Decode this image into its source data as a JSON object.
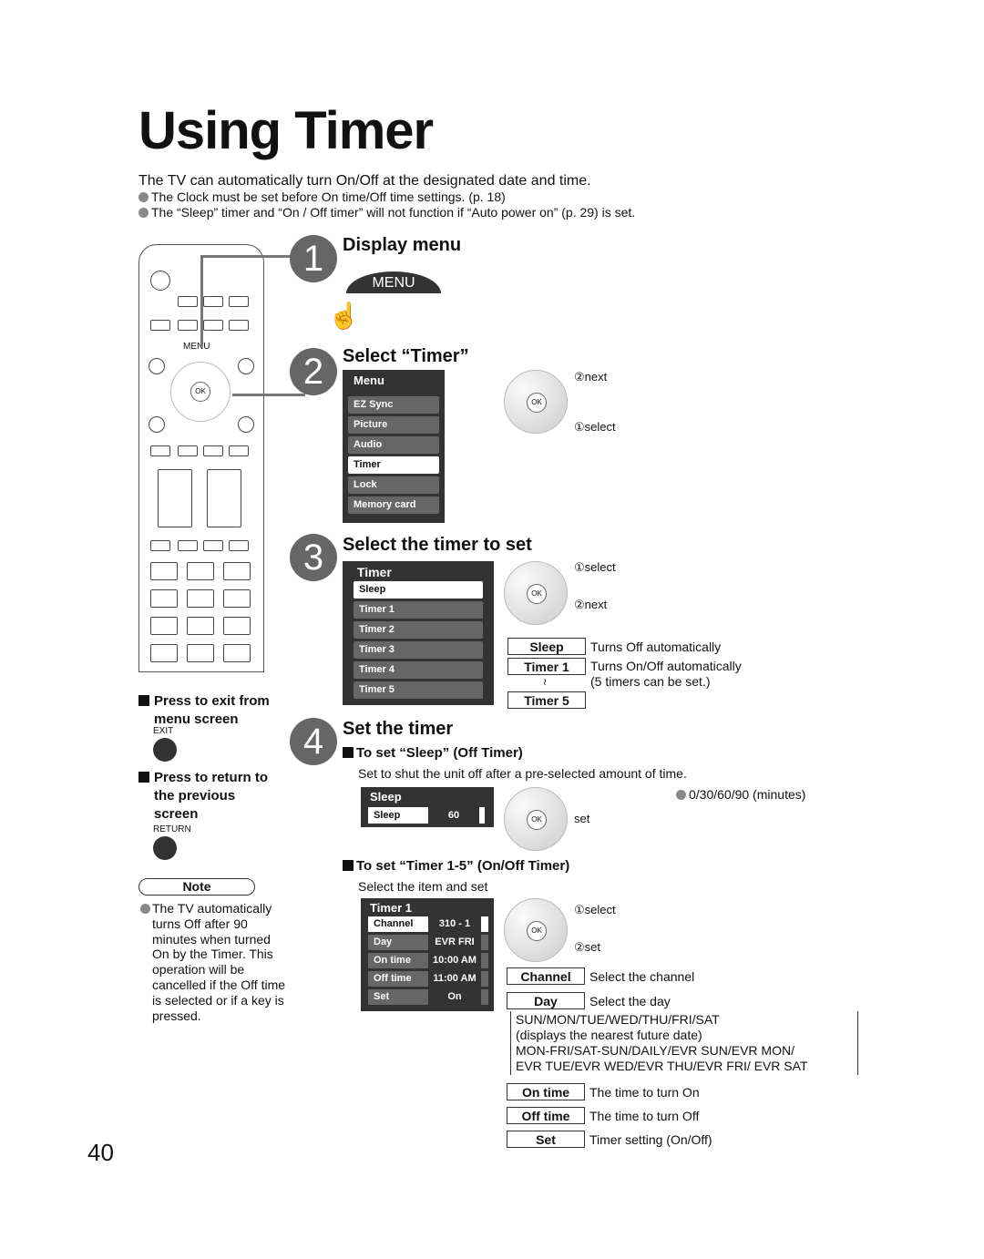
{
  "title": "Using Timer",
  "intro": "The TV can automatically turn On/Off at the designated date and time.",
  "bullets": [
    "The Clock must be set before On time/Off time settings. (p. 18)",
    "The “Sleep” timer and “On / Off timer” will not function if “Auto power on” (p. 29) is set."
  ],
  "remote": {
    "menu_label": "MENU",
    "ok_label": "OK"
  },
  "steps": [
    {
      "num": "1",
      "title": "Display menu",
      "button": "MENU"
    },
    {
      "num": "2",
      "title": "Select “Timer”",
      "menu": {
        "header": "Menu",
        "items": [
          "EZ Sync",
          "Picture",
          "Audio",
          "Timer",
          "Lock",
          "Memory card"
        ]
      },
      "next": "②next",
      "select": "①select"
    },
    {
      "num": "3",
      "title": "Select the timer to set",
      "menu": {
        "header": "Timer",
        "items": [
          "Sleep",
          "Timer 1",
          "Timer 2",
          "Timer 3",
          "Timer 4",
          "Timer 5"
        ]
      },
      "select": "①select",
      "next": "②next",
      "keys": [
        {
          "key": "Sleep",
          "desc": "Turns Off automatically"
        },
        {
          "key": "Timer 1",
          "desc": "Turns On/Off automatically"
        },
        {
          "key": "Timer 5",
          "desc": "(5 timers can be set.)"
        }
      ],
      "tilde": "≀"
    },
    {
      "num": "4",
      "title": "Set the timer"
    }
  ],
  "sleep": {
    "heading": "To set “Sleep” (Off Timer)",
    "desc": "Set to shut the unit off after a pre-selected amount of time.",
    "osd_header": "Sleep",
    "osd_label": "Sleep",
    "osd_value": "60",
    "set": "set",
    "options": "0/30/60/90 (minutes)"
  },
  "timer": {
    "heading": "To set “Timer 1-5” (On/Off Timer)",
    "desc": "Select the item and set",
    "osd_header": "Timer 1",
    "rows": [
      {
        "k": "Channel",
        "v": "310 - 1"
      },
      {
        "k": "Day",
        "v": "EVR FRI"
      },
      {
        "k": "On time",
        "v": "10:00 AM"
      },
      {
        "k": "Off time",
        "v": "11:00 AM"
      },
      {
        "k": "Set",
        "v": "On"
      }
    ],
    "select": "①select",
    "set": "②set",
    "keys": [
      {
        "key": "Channel",
        "desc": "Select the channel"
      },
      {
        "key": "Day",
        "desc": "Select the day"
      },
      {
        "key": "On time",
        "desc": "The time to turn On"
      },
      {
        "key": "Off time",
        "desc": "The time to turn Off"
      },
      {
        "key": "Set",
        "desc": "Timer setting (On/Off)"
      }
    ],
    "day_options": [
      "SUN/MON/TUE/WED/THU/FRI/SAT",
      "(displays the nearest future date)",
      "MON-FRI/SAT-SUN/DAILY/EVR SUN/EVR MON/",
      "EVR TUE/EVR WED/EVR THU/EVR FRI/ EVR SAT"
    ]
  },
  "side": {
    "exit_heading": "Press to exit from menu screen",
    "exit_label": "EXIT",
    "return_heading": "Press to return to the previous screen",
    "return_label": "RETURN",
    "note_label": "Note",
    "note_text": "The TV automatically turns Off after 90 minutes when turned On by the Timer. This operation will be cancelled if the Off time is selected or if a key is pressed."
  },
  "page_number": "40"
}
